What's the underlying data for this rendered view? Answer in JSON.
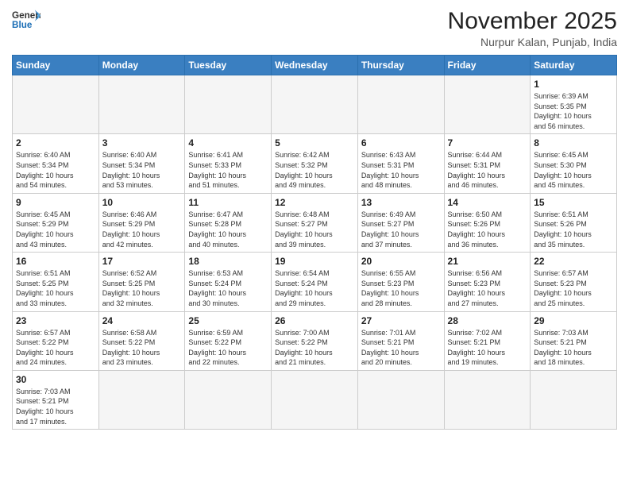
{
  "logo": {
    "text_general": "General",
    "text_blue": "Blue"
  },
  "title": "November 2025",
  "subtitle": "Nurpur Kalan, Punjab, India",
  "days_of_week": [
    "Sunday",
    "Monday",
    "Tuesday",
    "Wednesday",
    "Thursday",
    "Friday",
    "Saturday"
  ],
  "weeks": [
    [
      {
        "day": "",
        "info": "",
        "empty": true
      },
      {
        "day": "",
        "info": "",
        "empty": true
      },
      {
        "day": "",
        "info": "",
        "empty": true
      },
      {
        "day": "",
        "info": "",
        "empty": true
      },
      {
        "day": "",
        "info": "",
        "empty": true
      },
      {
        "day": "",
        "info": "",
        "empty": true
      },
      {
        "day": "1",
        "info": "Sunrise: 6:39 AM\nSunset: 5:35 PM\nDaylight: 10 hours\nand 56 minutes."
      }
    ],
    [
      {
        "day": "2",
        "info": "Sunrise: 6:40 AM\nSunset: 5:34 PM\nDaylight: 10 hours\nand 54 minutes."
      },
      {
        "day": "3",
        "info": "Sunrise: 6:40 AM\nSunset: 5:34 PM\nDaylight: 10 hours\nand 53 minutes."
      },
      {
        "day": "4",
        "info": "Sunrise: 6:41 AM\nSunset: 5:33 PM\nDaylight: 10 hours\nand 51 minutes."
      },
      {
        "day": "5",
        "info": "Sunrise: 6:42 AM\nSunset: 5:32 PM\nDaylight: 10 hours\nand 49 minutes."
      },
      {
        "day": "6",
        "info": "Sunrise: 6:43 AM\nSunset: 5:31 PM\nDaylight: 10 hours\nand 48 minutes."
      },
      {
        "day": "7",
        "info": "Sunrise: 6:44 AM\nSunset: 5:31 PM\nDaylight: 10 hours\nand 46 minutes."
      },
      {
        "day": "8",
        "info": "Sunrise: 6:45 AM\nSunset: 5:30 PM\nDaylight: 10 hours\nand 45 minutes."
      }
    ],
    [
      {
        "day": "9",
        "info": "Sunrise: 6:45 AM\nSunset: 5:29 PM\nDaylight: 10 hours\nand 43 minutes."
      },
      {
        "day": "10",
        "info": "Sunrise: 6:46 AM\nSunset: 5:29 PM\nDaylight: 10 hours\nand 42 minutes."
      },
      {
        "day": "11",
        "info": "Sunrise: 6:47 AM\nSunset: 5:28 PM\nDaylight: 10 hours\nand 40 minutes."
      },
      {
        "day": "12",
        "info": "Sunrise: 6:48 AM\nSunset: 5:27 PM\nDaylight: 10 hours\nand 39 minutes."
      },
      {
        "day": "13",
        "info": "Sunrise: 6:49 AM\nSunset: 5:27 PM\nDaylight: 10 hours\nand 37 minutes."
      },
      {
        "day": "14",
        "info": "Sunrise: 6:50 AM\nSunset: 5:26 PM\nDaylight: 10 hours\nand 36 minutes."
      },
      {
        "day": "15",
        "info": "Sunrise: 6:51 AM\nSunset: 5:26 PM\nDaylight: 10 hours\nand 35 minutes."
      }
    ],
    [
      {
        "day": "16",
        "info": "Sunrise: 6:51 AM\nSunset: 5:25 PM\nDaylight: 10 hours\nand 33 minutes."
      },
      {
        "day": "17",
        "info": "Sunrise: 6:52 AM\nSunset: 5:25 PM\nDaylight: 10 hours\nand 32 minutes."
      },
      {
        "day": "18",
        "info": "Sunrise: 6:53 AM\nSunset: 5:24 PM\nDaylight: 10 hours\nand 30 minutes."
      },
      {
        "day": "19",
        "info": "Sunrise: 6:54 AM\nSunset: 5:24 PM\nDaylight: 10 hours\nand 29 minutes."
      },
      {
        "day": "20",
        "info": "Sunrise: 6:55 AM\nSunset: 5:23 PM\nDaylight: 10 hours\nand 28 minutes."
      },
      {
        "day": "21",
        "info": "Sunrise: 6:56 AM\nSunset: 5:23 PM\nDaylight: 10 hours\nand 27 minutes."
      },
      {
        "day": "22",
        "info": "Sunrise: 6:57 AM\nSunset: 5:23 PM\nDaylight: 10 hours\nand 25 minutes."
      }
    ],
    [
      {
        "day": "23",
        "info": "Sunrise: 6:57 AM\nSunset: 5:22 PM\nDaylight: 10 hours\nand 24 minutes."
      },
      {
        "day": "24",
        "info": "Sunrise: 6:58 AM\nSunset: 5:22 PM\nDaylight: 10 hours\nand 23 minutes."
      },
      {
        "day": "25",
        "info": "Sunrise: 6:59 AM\nSunset: 5:22 PM\nDaylight: 10 hours\nand 22 minutes."
      },
      {
        "day": "26",
        "info": "Sunrise: 7:00 AM\nSunset: 5:22 PM\nDaylight: 10 hours\nand 21 minutes."
      },
      {
        "day": "27",
        "info": "Sunrise: 7:01 AM\nSunset: 5:21 PM\nDaylight: 10 hours\nand 20 minutes."
      },
      {
        "day": "28",
        "info": "Sunrise: 7:02 AM\nSunset: 5:21 PM\nDaylight: 10 hours\nand 19 minutes."
      },
      {
        "day": "29",
        "info": "Sunrise: 7:03 AM\nSunset: 5:21 PM\nDaylight: 10 hours\nand 18 minutes."
      }
    ],
    [
      {
        "day": "30",
        "info": "Sunrise: 7:03 AM\nSunset: 5:21 PM\nDaylight: 10 hours\nand 17 minutes."
      },
      {
        "day": "",
        "info": "",
        "empty": true
      },
      {
        "day": "",
        "info": "",
        "empty": true
      },
      {
        "day": "",
        "info": "",
        "empty": true
      },
      {
        "day": "",
        "info": "",
        "empty": true
      },
      {
        "day": "",
        "info": "",
        "empty": true
      },
      {
        "day": "",
        "info": "",
        "empty": true
      }
    ]
  ]
}
